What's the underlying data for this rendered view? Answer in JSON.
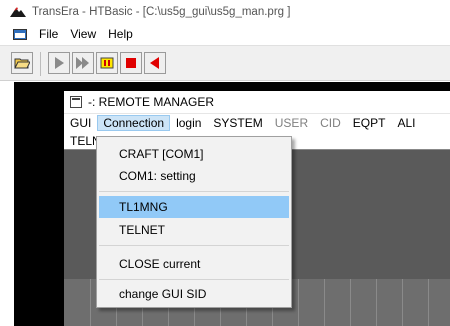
{
  "app": {
    "title": "TransEra - HTBasic - [C:\\us5g_gui\\us5g_man.prg ]"
  },
  "menubar": {
    "items": [
      "File",
      "View",
      "Help"
    ]
  },
  "toolbar": {
    "icons": [
      "open-folder-icon",
      "run-icon",
      "continue-icon",
      "pause-icon",
      "stop-icon",
      "step-back-icon"
    ]
  },
  "child": {
    "title": "-: REMOTE MANAGER",
    "menu": [
      "GUI",
      "Connection",
      "login",
      "SYSTEM",
      "USER",
      "CID",
      "EQPT",
      "ALI"
    ],
    "menu_row2": [
      "TELN"
    ],
    "active_menu": "Connection"
  },
  "dropdown": {
    "items": [
      "CRAFT [COM1]",
      "COM1: setting",
      "TL1MNG",
      "TELNET",
      "CLOSE current",
      "change GUI SID"
    ],
    "highlighted": "TL1MNG"
  },
  "colors": {
    "highlight": "#91c9f7",
    "menu_active": "#cce4f7",
    "mdi_background": "#000000",
    "child_body": "#5a5a5a"
  }
}
